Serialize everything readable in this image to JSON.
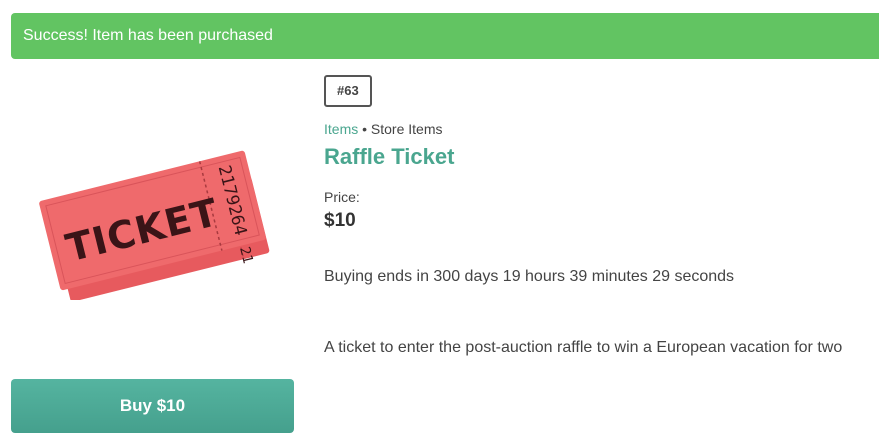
{
  "alert": {
    "message": "Success! Item has been purchased",
    "color": "#62c462"
  },
  "item": {
    "badge": "#63",
    "breadcrumb_link": "Items",
    "breadcrumb_separator": "•",
    "breadcrumb_current": "Store Items",
    "title": "Raffle Ticket",
    "price_label": "Price:",
    "price": "$10",
    "countdown": "Buying ends in 300 days 19 hours 39 minutes 29 seconds",
    "description": "A ticket to enter the post-auction raffle to win a European vacation for two",
    "image": {
      "icon": "ticket-icon",
      "main_text": "TICKET",
      "serial": "2179264",
      "stub_text": "21",
      "color": "#ef6a6c"
    }
  },
  "actions": {
    "buy_label": "Buy $10"
  },
  "colors": {
    "accent": "#4aa68f",
    "button": "#4fab97",
    "success": "#62c462"
  }
}
